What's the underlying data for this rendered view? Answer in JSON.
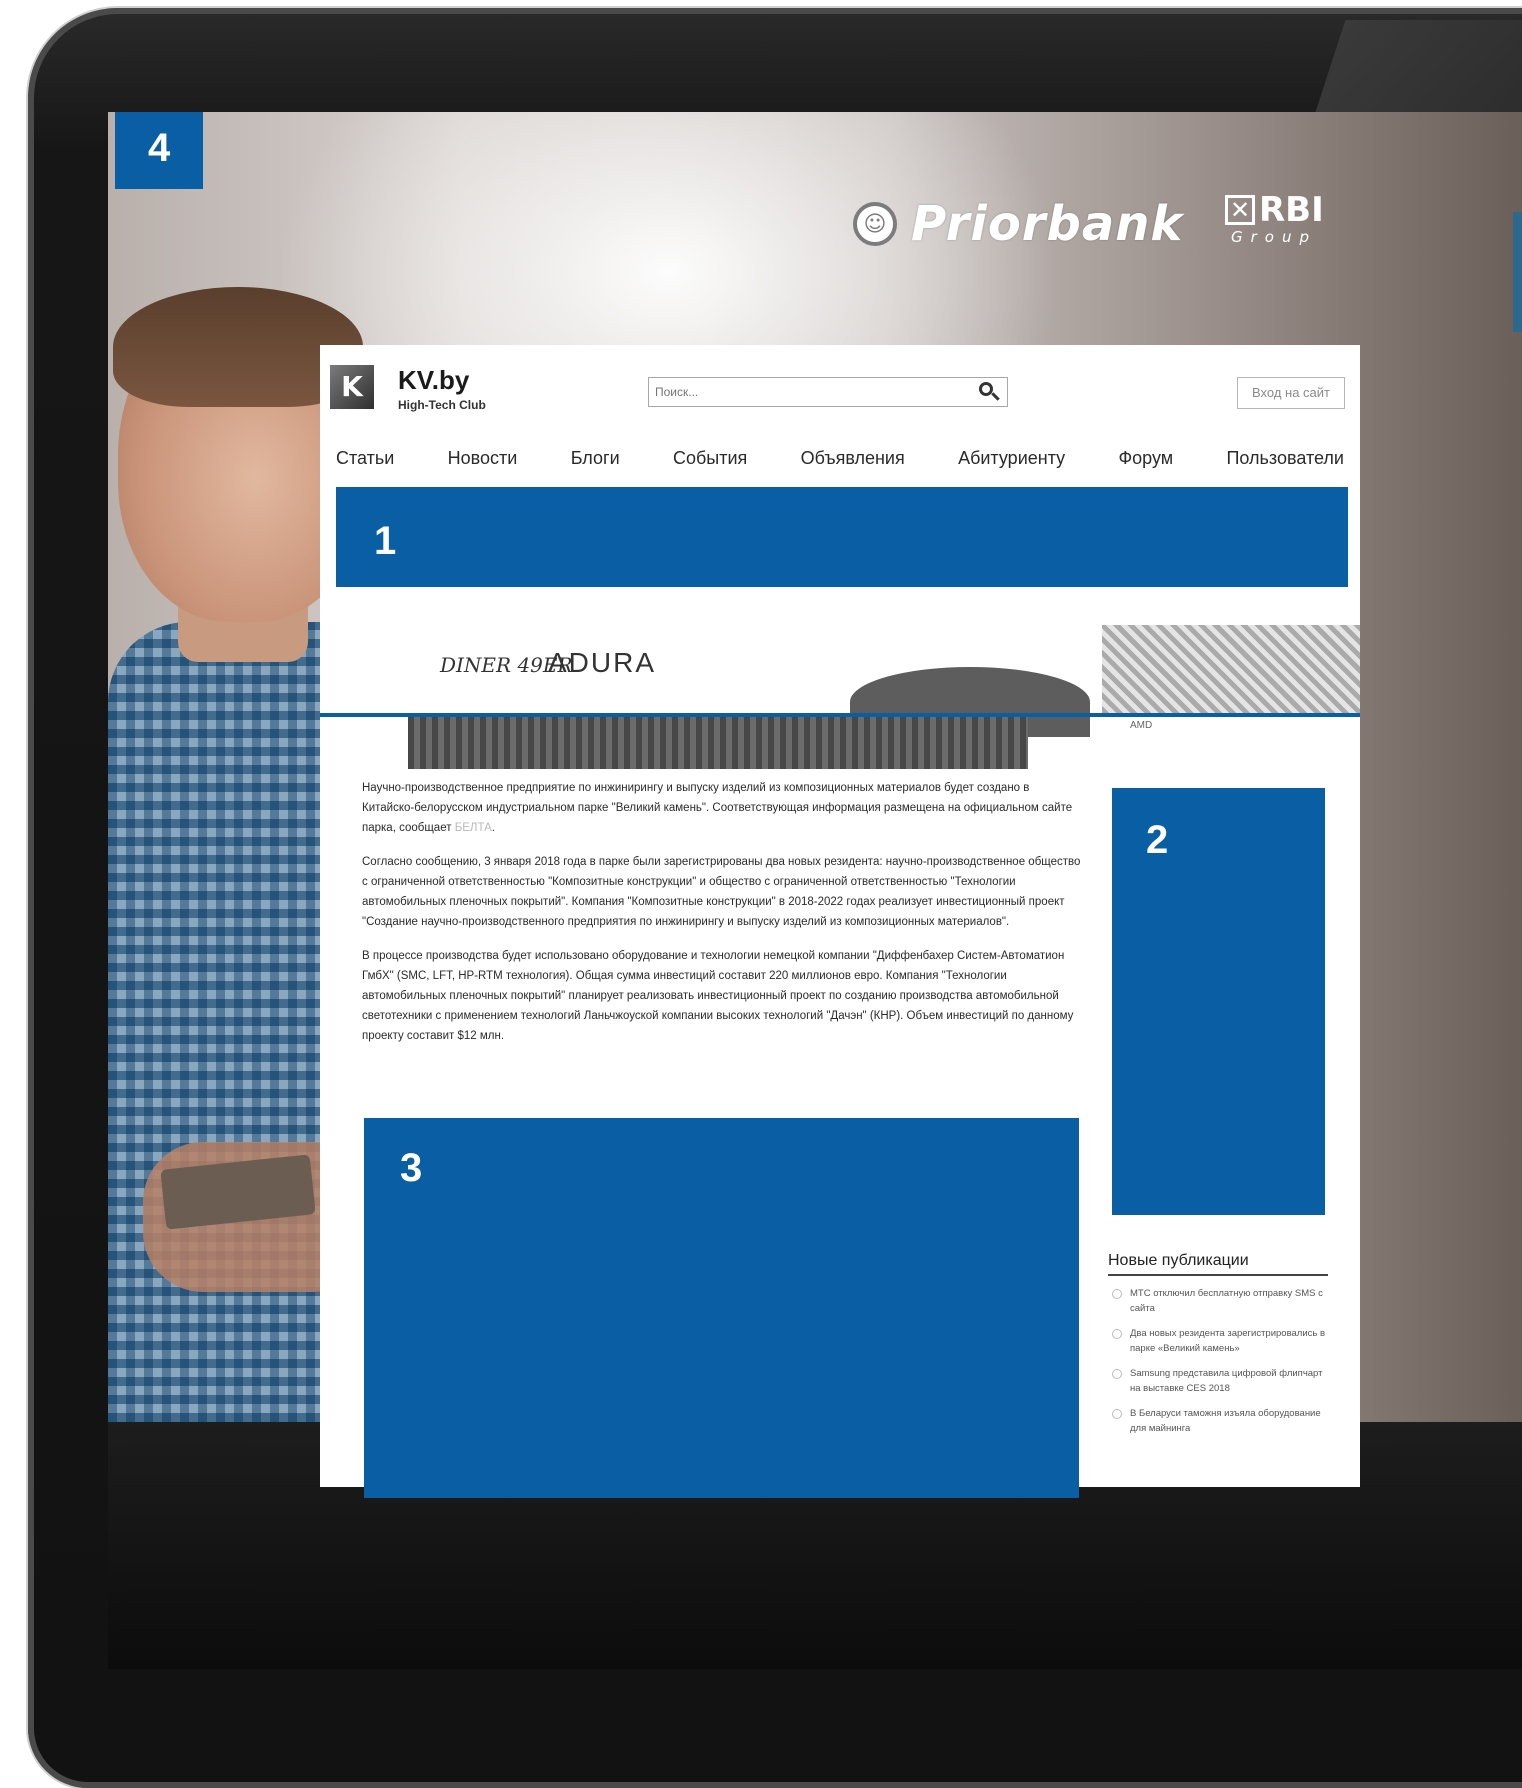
{
  "sponsor": {
    "name": "Priorbank",
    "group_mark": "RBI",
    "group_label": "Group"
  },
  "placeholders": {
    "p1": "1",
    "p2": "2",
    "p3": "3",
    "p4": "4"
  },
  "site": {
    "logo_mark": "K",
    "name": "KV.by",
    "tagline": "High-Tech Club",
    "search_placeholder": "Поиск...",
    "login_label": "Вход на сайт",
    "nav": [
      "Статьи",
      "Новости",
      "Блоги",
      "События",
      "Объявления",
      "Абитуриенту",
      "Форум",
      "Пользователи"
    ]
  },
  "banner": {
    "brand_diner": "DINER 49ER",
    "brand_adura": "ADURA",
    "caption": "AMD"
  },
  "article": {
    "p1_text": "Научно-производственное предприятие по инжинирингу и выпуску изделий из композиционных материалов будет создано в Китайско-белорусском индустриальном парке \"Великий камень\". Соответствующая информация размещена на официальном сайте парка, сообщает ",
    "p1_source": "БЕЛТА",
    "p1_end": ".",
    "p2": "Согласно сообщению, 3 января 2018 года в парке были зарегистрированы два новых резидента: научно-производственное общество с ограниченной ответственностью \"Композитные конструкции\" и общество с ограниченной ответственностью \"Технологии автомобильных пленочных покрытий\". Компания \"Композитные конструкции\" в 2018-2022 годах реализует инвестиционный проект \"Создание научно-производственного предприятия по инжинирингу и выпуску изделий из композиционных материалов\".",
    "p3": "В процессе производства будет использовано оборудование и технологии немецкой компании \"Диффенбахер Систем-Автоматион ГмбХ\" (SMC, LFT, HP-RTM технология). Общая сумма инвестиций составит 220 миллионов евро. Компания \"Технологии автомобильных пленочных покрытий\" планирует реализовать инвестиционный проект по созданию производства автомобильной светотехники с применением технологий Ланьчжоуской компании высоких технологий \"Дачэн\" (КНР). Объем инвестиций по данному проекту составит $12 млн."
  },
  "sidebar": {
    "title": "Новые публикации",
    "items": [
      "МТС отключил бесплатную отправку SMS с сайта",
      "Два новых резидента зарегистрировались в парке «Великий камень»",
      "Samsung представила цифровой флипчарт на выставке CES 2018",
      "В Беларуси таможня изъяла оборудование для майнинга"
    ]
  },
  "colors": {
    "placeholder_blue": "#0a5fa4"
  }
}
